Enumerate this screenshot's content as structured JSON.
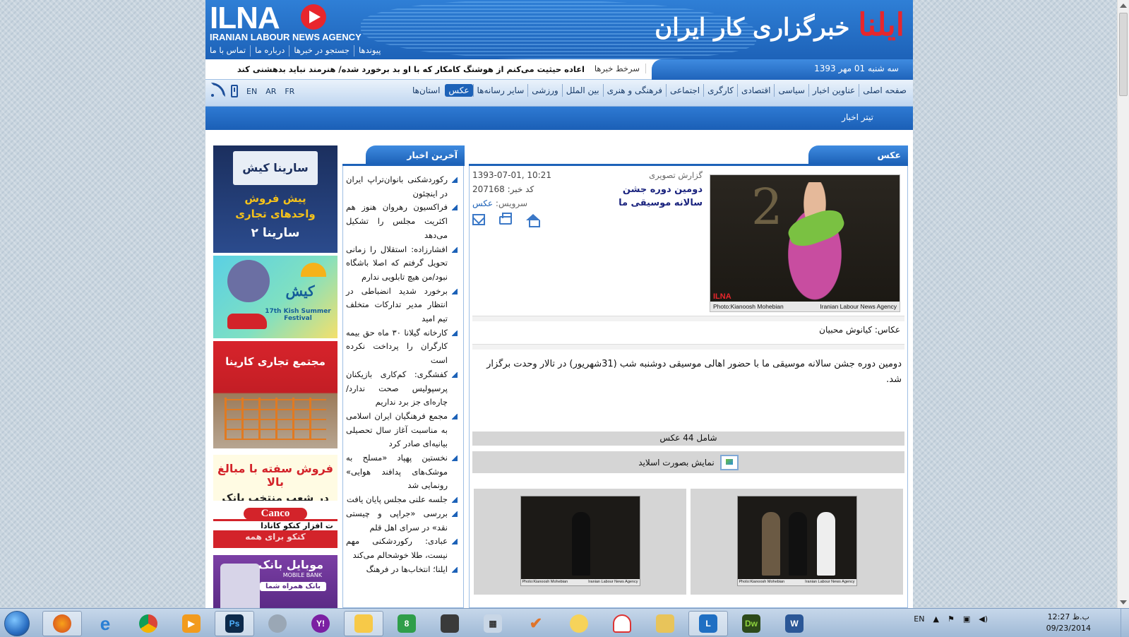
{
  "header": {
    "logo_text": "ILNA",
    "agency_en": "IRANIAN LABOUR NEWS AGENCY",
    "brand_fa_main": "ایلنا",
    "brand_fa_sub": "خبرگزاری کار ایران",
    "links": [
      "پیوندها",
      "جستجو در خبرها",
      "درباره ما",
      "تماس با ما"
    ]
  },
  "ticker": {
    "date": "سه شنبه 01 مهر 1393",
    "label": "سرخط خبرها",
    "text": "اعاده حیثیت می‌کنم از هوشنگ کامکار که با او بد برخورد شده/ هنرمند نباید بدهشنی کند"
  },
  "nav": {
    "items": [
      "صفحه اصلی",
      "عناوین اخبار",
      "سیاسی",
      "اقتصادی",
      "کارگری",
      "اجتماعی",
      "فرهنگی و هنری",
      "بین الملل",
      "ورزشی",
      "سایر رسانه‌ها",
      "عکس",
      "استان‌ها"
    ],
    "active": "عکس",
    "langs": [
      "EN",
      "AR",
      "FR"
    ]
  },
  "subbar": {
    "label": "تیتر اخبار"
  },
  "latest": {
    "title": "آخرین اخبار",
    "items": [
      "رکوردشکنی بانوان‌تراپ ایران در اینچئون",
      "فراکسیون رهروان هنوز هم اکثریت مجلس را تشکیل می‌دهد",
      "افشارزاده: استقلال را زمانی تحویل گرفتم که اصلا باشگاه نبود/من هیچ تابلویی ندارم",
      "برخورد شدید انضباطی در انتظار مدیر تدارکات متخلف تیم امید",
      "کارخانه گیلانا ۳۰ ماه حق بیمه کارگران را پرداخت نکرده است",
      "کفشگری: کم‌کاری بازیکنان پرسپولیس صحت ندارد/چاره‌ای جز برد نداریم",
      "مجمع فرهنگیان ایران اسلامی به مناسبت آغاز سال تحصیلی بیانیه‌ای صادر کرد",
      "نخستین پهپاد «مسلح به موشک‌های پدافند هوایی» رونمایی شد",
      "جلسه علنی مجلس پایان یافت",
      "بررسی «جراپی و چیستی نقد» در سرای اهل قلم",
      "عبادی: رکوردشکنی مهم نیست، طلا خوشحالم می‌کند",
      "ایلنا؛ انتخاب‌ها در فرهنگ"
    ]
  },
  "ads": {
    "ad1": {
      "logo": "سارینا کیش",
      "line1": "پیش فروش",
      "line2": "واحدهای تجاری",
      "line3": "سارینا ۲"
    },
    "ad2": {
      "title": "کیش",
      "sub": "17th Kish Summer Festival"
    },
    "ad3": {
      "title": "مجتمع تجاری کارینا"
    },
    "ad4": {
      "line1": "فروش سفته با مبالغ بالا",
      "line2": "در شعب منتخب بانک ملی ایران"
    },
    "ad5": {
      "brand": "Canco",
      "line1": "ت افزار کنکو کانادا",
      "line2": "کنکو برای همه"
    },
    "ad6": {
      "title": "موبایل بانک",
      "en": "MOBILE BANK",
      "pill": "بانک همراه شما"
    }
  },
  "article": {
    "section": "عکس",
    "kicker": "گزارش تصویری",
    "title": "دومین دوره جشن سالانه موسیقی ما",
    "datetime": "1393-07-01, 10:21",
    "code_label": "کد خبر:",
    "code": "207168",
    "service_label": "سرویس:",
    "service": "عکس",
    "photo_credit_left": "Photo:Kianoosh Mohebian",
    "photo_credit_right": "Iranian Labour News Agency",
    "photo_logo": "ILNA",
    "credit": "عکاس: کیانوش محبیان",
    "body": "دومین دوره جشن سالانه موسیقی ما با حضور اهالی موسیقی دوشنبه شب (31شهریور) در تالار وحدت برگزار شد.",
    "count": "شامل 44 عکس",
    "slideshow": "نمایش بصورت اسلاید",
    "thumbs": [
      {
        "left": "Photo:Kianoosh Mohebian",
        "right": "Iranian Labour News Agency"
      },
      {
        "left": "Photo:Kianoosh Mohebian",
        "right": "Iranian Labour News Agency"
      }
    ]
  },
  "taskbar": {
    "apps": [
      "firefox",
      "internet-explorer",
      "chrome",
      "media-player",
      "photoshop",
      "utility",
      "yahoo-messenger",
      "outlook",
      "windows8-app",
      "video-maker",
      "calculator",
      "task-check",
      "sticker",
      "speedtest",
      "folder",
      "lync",
      "dreamweaver",
      "word"
    ],
    "lang": "EN",
    "time": "12:27 ب.ظ",
    "date": "09/23/2014"
  },
  "colors": {
    "brand_blue": "#1d62b8",
    "brand_red": "#e8262c"
  }
}
